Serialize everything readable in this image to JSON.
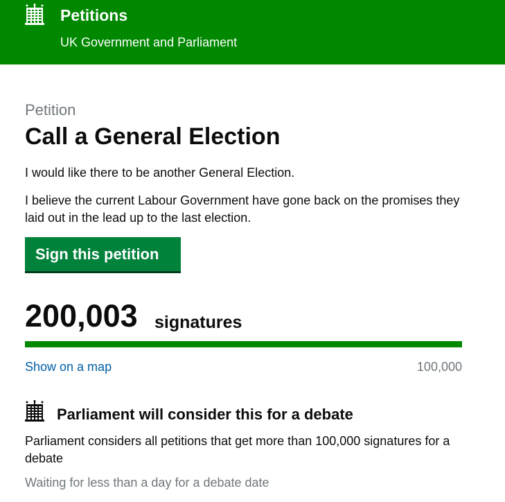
{
  "header": {
    "title": "Petitions",
    "subtitle": "UK Government and Parliament",
    "logo_icon": "portcullis-icon",
    "background": "#008800"
  },
  "petition": {
    "caption": "Petition",
    "title": "Call a General Election",
    "paragraphs": [
      "I would like there to be another General Election.",
      "I believe the current Labour Government have gone back on the promises they laid out in the lead up to the last election."
    ],
    "sign_button": "Sign this petition"
  },
  "signatures": {
    "count": "200,003",
    "label": "signatures",
    "progress_fraction": 1.0,
    "map_link": "Show on a map",
    "threshold": "100,000"
  },
  "debate": {
    "icon": "portcullis-icon",
    "heading": "Parliament will consider this for a debate",
    "description": "Parliament considers all petitions that get more than 100,000 signatures for a debate",
    "status": "Waiting for less than a day for a debate date"
  }
}
